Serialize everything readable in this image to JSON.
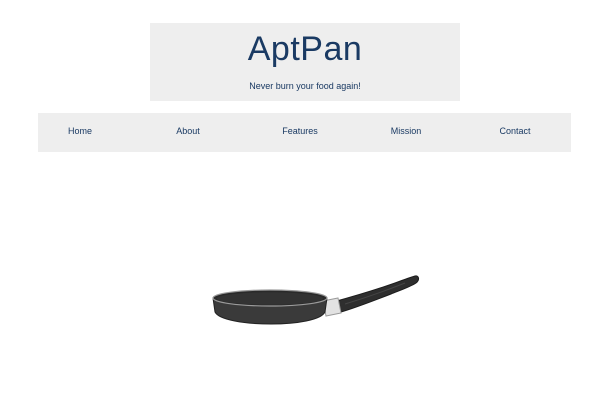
{
  "header": {
    "title": "AptPan",
    "tagline": "Never burn your food again!"
  },
  "nav": {
    "items": [
      {
        "label": "Home"
      },
      {
        "label": "About"
      },
      {
        "label": "Features"
      },
      {
        "label": "Mission"
      },
      {
        "label": "Contact"
      }
    ]
  },
  "hero": {
    "image": "frying-pan-illustration"
  },
  "colors": {
    "text": "#1a3a63",
    "panel_background": "#eeeeee",
    "page_background": "#ffffff",
    "pan_body": "#3a3a3a",
    "pan_rim": "#2a2a2a",
    "pan_collar": "#e0e0e0"
  }
}
